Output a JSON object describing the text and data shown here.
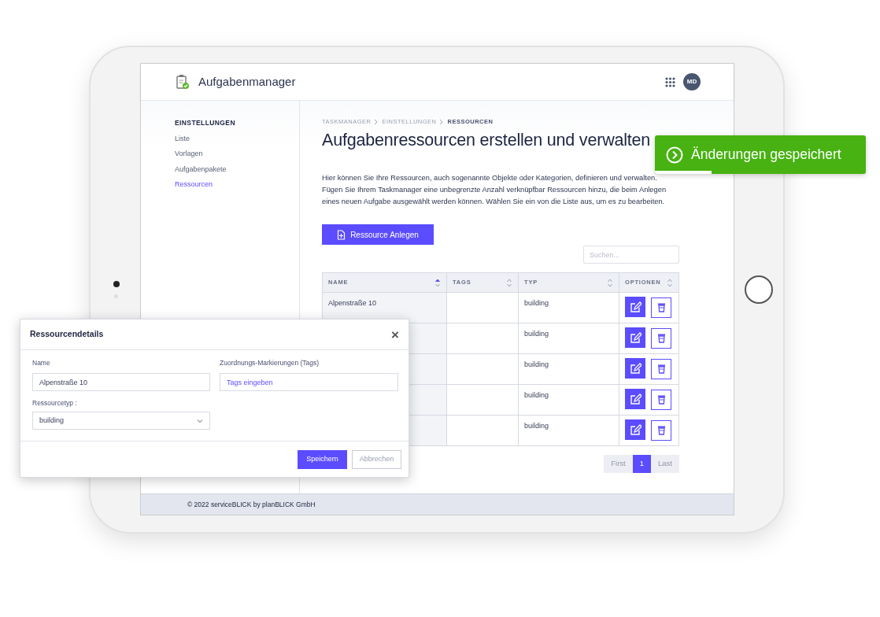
{
  "header": {
    "app_title": "Aufgabenmanager",
    "avatar_initials": "MD"
  },
  "sidebar": {
    "heading": "EINSTELLUNGEN",
    "items": [
      {
        "label": "Liste",
        "selected": false
      },
      {
        "label": "Vorlagen",
        "selected": false
      },
      {
        "label": "Aufgabenpakete",
        "selected": false
      },
      {
        "label": "Ressourcen",
        "selected": true
      }
    ]
  },
  "breadcrumb": [
    "TASKMANAGER",
    "EINSTELLUNGEN",
    "RESSOURCEN"
  ],
  "page_title": "Aufgabenressourcen erstellen und verwalten",
  "intro": "Hier können Sie Ihre Ressourcen, auch sogenannte Objekte oder Kategorien, definieren und verwalten. Fügen Sie Ihrem Taskmanager eine unbegrenzte Anzahl verknüpfbar Ressourcen hinzu, die beim Anlegen eines neuen Aufgabe ausgewählt werden können. Wählen Sie ein von die Liste aus, um es zu bearbeiten.",
  "create_button": "Ressource Anlegen",
  "search": {
    "placeholder": "Suchen..."
  },
  "table": {
    "columns": [
      {
        "label": "NAME",
        "sorted": true
      },
      {
        "label": "TAGS",
        "sorted": false
      },
      {
        "label": "TYP",
        "sorted": false
      },
      {
        "label": "OPTIONEN",
        "sorted": false
      }
    ],
    "rows": [
      {
        "name": "Alpenstraße 10",
        "type": "building"
      },
      {
        "type": "building"
      },
      {
        "type": "building"
      },
      {
        "type": "building"
      },
      {
        "type": "building"
      }
    ]
  },
  "pagination": [
    {
      "label": "First",
      "selected": false,
      "disabled": true
    },
    {
      "label": "1",
      "selected": true,
      "disabled": false
    },
    {
      "label": "Last",
      "selected": false,
      "disabled": true
    }
  ],
  "footer": "© 2022 serviceBLICK by planBLICK GmbH",
  "toast": {
    "message": "Änderungen gespeichert",
    "level": 0.27
  },
  "modal": {
    "title": "Ressourcendetails",
    "close": "×",
    "name_label": "Name",
    "name_value": "Alpenstraße 10",
    "tags_label": "Zuordnungs-Markierungen (Tags)",
    "tags_placeholder": "Tags eingeben",
    "type_label": "Ressourcetyp :",
    "type_value": "building",
    "save": "Speichern",
    "cancel": "Abbrechen"
  }
}
